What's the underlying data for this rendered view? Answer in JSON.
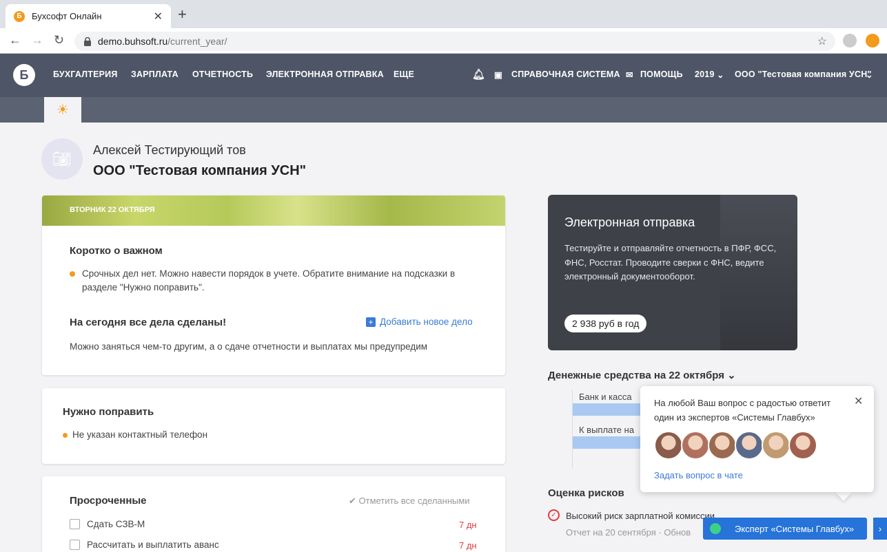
{
  "browser": {
    "tab_title": "Бухсофт Онлайн",
    "favicon_letter": "Б",
    "url_host": "demo.buhsoft.ru",
    "url_path": "/current_year/",
    "icons": [
      "back-arrow-icon",
      "forward-arrow-icon",
      "reload-icon",
      "lock-icon",
      "star-icon"
    ]
  },
  "header": {
    "logo_letter": "Б",
    "menu": [
      "БУХГАЛТЕРИЯ",
      "ЗАРПЛАТА",
      "ОТЧЕТНОСТЬ",
      "ЭЛЕКТРОННАЯ ОТПРАВКА",
      "ЕЩЕ"
    ],
    "help_system": "СПРАВОЧНАЯ СИСТЕМА",
    "help": "ПОМОЩЬ",
    "year": "2019",
    "org": "ООО \"Тестовая компания УСН\""
  },
  "profile": {
    "name": "Алексей Тестирующий тов",
    "company": "ООО \"Тестовая компания УСН\""
  },
  "day_card": {
    "date": "ВТОРНИК 22 ОКТЯБРЯ",
    "important_title": "Коротко о важном",
    "important_text": "Срочных дел нет. Можно навести порядок в учете. Обратите внимание на подсказки в разделе \"Нужно поправить\".",
    "done_title": "На сегодня все дела сделаны!",
    "add_task": "Добавить новое дело",
    "done_text": "Можно заняться чем-то другим, а о сдаче отчетности и выплатах мы предупредим"
  },
  "fix_card": {
    "title": "Нужно поправить",
    "item": "Не указан контактный телефон"
  },
  "overdue": {
    "title": "Просроченные",
    "mark_all": "✔ Отметить все сделанными",
    "items": [
      {
        "label": "Сдать СЗВ-М",
        "days": "7 дн"
      },
      {
        "label": "Рассчитать и выплатить аванс",
        "days": "7 дн"
      }
    ]
  },
  "edo": {
    "title": "Электронная отправка",
    "desc": "Тестируйте и отправляйте отчетность в ПФР, ФСС, ФНС, Росстат. Проводите сверки с ФНС, ведите электронный документооборот.",
    "price": "2 938 руб в год"
  },
  "money": {
    "title": "Денежные средства на 22 октября",
    "rows": [
      "Банк и касса",
      "К выплате на"
    ]
  },
  "risk": {
    "title": "Оценка рисков",
    "item": "Высокий риск зарплатной комиссии",
    "sub": "Отчет на 20 сентября  ·  Обнов"
  },
  "popup": {
    "text": "На любой Ваш вопрос с радостью ответит один из экспертов «Системы Главбух»",
    "link": "Задать вопрос в чате",
    "faces": [
      "#8a5a4a",
      "#b07060",
      "#9a6a50",
      "#5a6a8a",
      "#c09a70",
      "#a06050"
    ]
  },
  "chat": {
    "label": "Эксперт «Системы Главбух»"
  }
}
